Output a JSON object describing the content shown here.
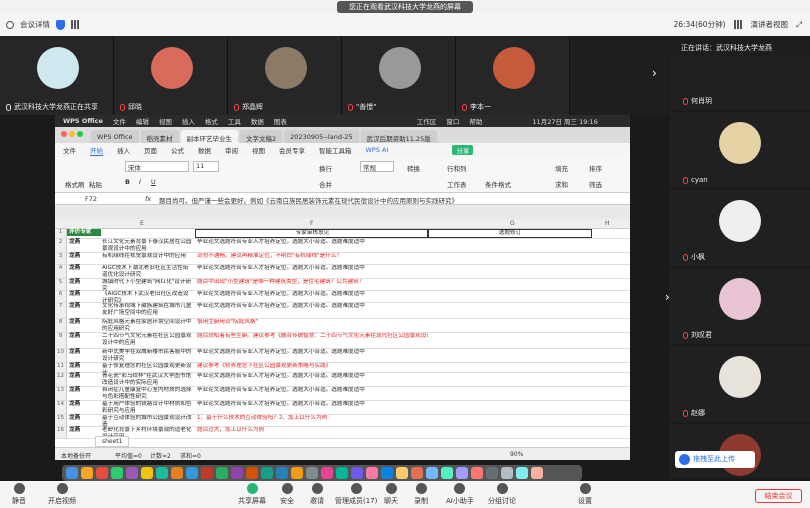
{
  "banner": "您正在观看武汉科技大学龙燕的屏幕",
  "topbar": {
    "info": "会议详情",
    "speaker_view_mode": "演讲者视图",
    "layout_icon": "grid",
    "timer": "26:34(60分钟)"
  },
  "participants": [
    {
      "name": "武汉科技大学龙燕正在共享",
      "mic": "on",
      "color": "#cfe7ef"
    },
    {
      "name": "邱晓",
      "mic": "off",
      "color": "#d86b5c"
    },
    {
      "name": "郑晶辉",
      "mic": "off",
      "color": "#8c7a66"
    },
    {
      "name": "\"善憬\"",
      "mic": "off",
      "color": "#999"
    },
    {
      "name": "李本一",
      "mic": "off",
      "color": "#c65a3d"
    }
  ],
  "speaking": "正在讲话：武汉科技大学龙燕",
  "right_panel": [
    {
      "name": "何肖玥",
      "color": "#9aa0a6"
    },
    {
      "name": "cyan",
      "color": "#e6d3a5"
    },
    {
      "name": "小枫",
      "color": "#eee"
    },
    {
      "name": "刘叹君",
      "color": "#e8c4d4"
    },
    {
      "name": "赵娜",
      "color": "#e7e2dc"
    },
    {
      "name": "",
      "color": "#8e3a2e"
    }
  ],
  "wps": {
    "macbar": [
      "WPS Office",
      "文件",
      "编辑",
      "视图",
      "插入",
      "格式",
      "工具",
      "数据",
      "图表",
      "工作区",
      "窗口",
      "帮助",
      "11月27日 周三 19:16"
    ],
    "tabs": [
      "WPS Office",
      "稻壳素材",
      "副本环艺毕业生",
      "文字文稿2",
      "20230905--land-25",
      "武汉后期资助11.25版"
    ],
    "menu": [
      "文件",
      "开始",
      "插入",
      "页面",
      "公式",
      "数据",
      "审阅",
      "视图",
      "会员专享",
      "智能工具箱",
      "WPS AI"
    ],
    "ribbon": {
      "format_painter": "格式刷",
      "paste": "粘贴",
      "font": "宋体",
      "size": "11",
      "wrap": "换行",
      "normal": "常规",
      "convert": "转换",
      "row_col": "行和列",
      "worksheet": "工作表",
      "cond_format": "条件格式",
      "fill": "填充",
      "sum": "求和",
      "sort": "排序",
      "filter": "筛选",
      "share": "分享",
      "merge": "合并"
    },
    "cell_ref": "F72",
    "formula": "题目尚可。但严谨一些会更好。例如《云南白族民居装饰元素在现代民宿设计中的应用原则与实践研究》",
    "columns": [
      "E",
      "F",
      "G",
      "H"
    ],
    "header_row": {
      "a": "评价专家",
      "f": "专家审核意见",
      "g": "选题修订"
    },
    "rows": [
      {
        "n": "2",
        "a": "龙燕",
        "e": "长江文化元素背景下泰汉民居在公园景观设计中的应用",
        "f": "毕业论文选题符合专业人才培养定位。选题大小合适。选题难度适中",
        "red": false
      },
      {
        "n": "3",
        "a": "龙燕",
        "e": "有机绿线在视觉景观设计中的应用",
        "f": "词句不通畅。建议再精准定位，不明白\"有机绿线\"是什么？",
        "red": true
      },
      {
        "n": "4",
        "a": "龙燕",
        "e": "AIGC技术下湖北老旧社区生活性街道优化设计研究",
        "f": "毕业论文选题符合专业人才培养定位。选题大小合适。选题难度适中",
        "red": false
      },
      {
        "n": "5",
        "a": "龙燕",
        "e": "城镇时代下小型建筑\"网红化\"设计研究",
        "f": "题目中出现\"小型建筑\"是哪一种建筑类型，是住宅建筑？公共建筑？",
        "red": true
      },
      {
        "n": "6",
        "a": "龙燕",
        "e": "《AIGC技术下武汉老旧社区改造设计研究》",
        "f": "毕业论文选题符合专业人才培养定位。选题大小合适。选题难度适中",
        "red": false
      },
      {
        "n": "7",
        "a": "龙燕",
        "e": "文化传承视域下藏族建筑在城市儿童友好广场空间中的应用",
        "f": "毕业论文选题符合专业人才培养定位。选题大小合适。选题难度适中",
        "red": false
      },
      {
        "n": "8",
        "a": "龙燕",
        "e": "院庭风格元素在家居环境空间设计中的应用研究",
        "f": "慎用生僻用词\"院庭风格\"",
        "red": true
      },
      {
        "n": "9",
        "a": "龙燕",
        "e": "二十四节气文化元素在社区公园景观设计中的应用",
        "f": "题目较松着有些生僻。建议参考《融合传统智慧：二十四节气文化元素在现代社区公园景观设计中的创新应用》",
        "red": true
      },
      {
        "n": "10",
        "a": "龙燕",
        "e": "新中式美学在双鹰新楼市民客服中的设计研究",
        "f": "毕业论文选题符合专业人才培养定位。选题大小合适。选题难度适中",
        "red": false
      },
      {
        "n": "11",
        "a": "龙燕",
        "e": "基于修复理念的社区公园景观更新设计",
        "f": "建议参考《修养理念下社区公园景观更新策略与实践》",
        "red": true
      },
      {
        "n": "12",
        "a": "龙燕",
        "e": "青花瓷\"彩乌纹样\"在武汉大学图书馆改造设计中的实际应用",
        "f": "毕业论文选题符合专业人才培养定位。选题大小合适。选题难度适中",
        "red": false
      },
      {
        "n": "13",
        "a": "龙燕",
        "e": "自闭症儿童康复中心室内材质的选择与色彩搭配性研究",
        "f": "毕业论文选题符合专业人才培养定位。选题大小合适。选题难度适中",
        "red": false
      },
      {
        "n": "14",
        "a": "龙燕",
        "e": "基于用户体验的铁路设计中材质和色彩研究与应用",
        "f": "毕业论文选题符合专业人才培养定位。选题大小合适。选题难度适中",
        "red": false
      },
      {
        "n": "15",
        "a": "龙燕",
        "e": "基于互动体验的城市公园景观设计改造",
        "f": "1、基于什么技术的互动体验吗？2、加上以什么为例",
        "red": true
      },
      {
        "n": "16",
        "a": "龙燕",
        "e": "老龄化背景下乡村环境景观的适老化设计应用",
        "f": "题目过大，加上以什么为例",
        "red": true
      }
    ],
    "sheet_tab": "sheet1",
    "status": {
      "left": "本地备份开",
      "avg": "平均值=0",
      "count": "计数=2",
      "sum": "求和=0",
      "zoom": "90%"
    }
  },
  "upload_btn": "拖拽至此上传",
  "bottom": {
    "items": [
      "静音",
      "开启视频",
      "共享屏幕",
      "安全",
      "邀请",
      "管理成员(17)",
      "聊天",
      "录制",
      "AI小助手",
      "分组讨论",
      "设置"
    ],
    "end": "结束会议"
  }
}
